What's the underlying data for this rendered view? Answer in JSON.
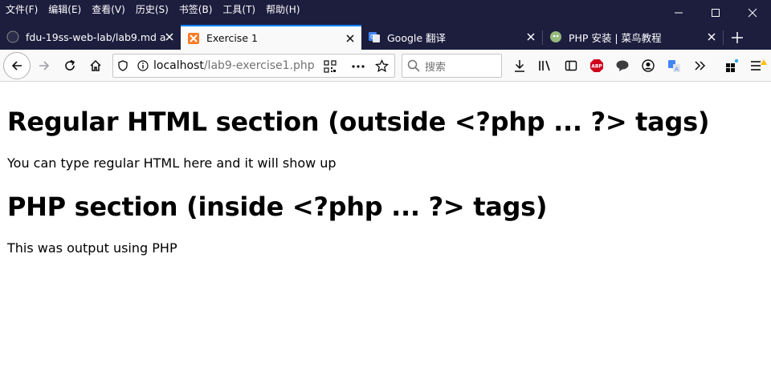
{
  "menubar": {
    "items": [
      "文件(F)",
      "编辑(E)",
      "查看(V)",
      "历史(S)",
      "书签(B)",
      "工具(T)",
      "帮助(H)"
    ]
  },
  "tabs": [
    {
      "title": "fdu-19ss-web-lab/lab9.md a",
      "favicon": "github-icon",
      "active": false
    },
    {
      "title": "Exercise 1",
      "favicon": "xampp-icon",
      "active": true
    },
    {
      "title": "Google 翻译",
      "favicon": "google-translate-icon",
      "active": false
    },
    {
      "title": "PHP 安装 | 菜鸟教程",
      "favicon": "runoob-icon",
      "active": false
    }
  ],
  "urlbar": {
    "host": "localhost",
    "path": "/lab9-exercise1.php"
  },
  "search": {
    "placeholder": "搜索"
  },
  "colors": {
    "titlebar": "#1d1d3e",
    "tab_active_accent": "#0a84ff",
    "toolbar_bg": "#f9f9fa",
    "adblock_red": "#d0021b"
  },
  "page": {
    "heading1": "Regular HTML section (outside <?php ... ?> tags)",
    "para1": "You can type regular HTML here and it will show up",
    "heading2": "PHP section (inside <?php ... ?> tags)",
    "para2": "This was output using PHP"
  }
}
